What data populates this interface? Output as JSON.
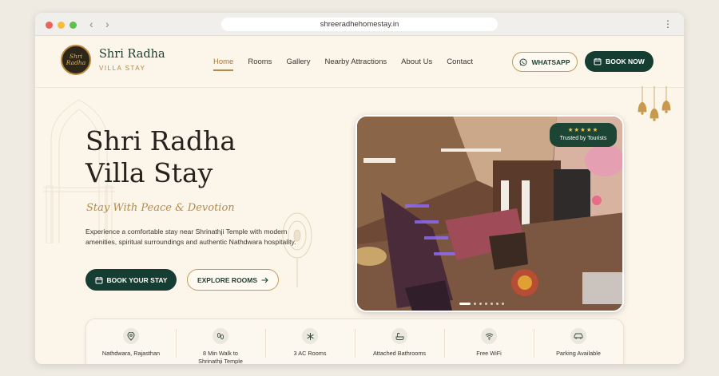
{
  "browser": {
    "url": "shreeradhehomestay.in"
  },
  "brand": {
    "name": "Shri Radha",
    "subtitle": "VILLA STAY",
    "logo_text": "Shri Radha",
    "accent_color": "#b58b46",
    "primary_color": "#163d31"
  },
  "nav": {
    "items": [
      "Home",
      "Rooms",
      "Gallery",
      "Nearby Attractions",
      "About Us",
      "Contact"
    ],
    "active": "Home"
  },
  "header_buttons": {
    "whatsapp": "WHATSAPP",
    "book_now": "BOOK NOW"
  },
  "hero": {
    "title_line1": "Shri Radha",
    "title_line2": "Villa Stay",
    "tagline": "Stay With Peace & Devotion",
    "description": "Experience a comfortable stay near Shrinathji Temple with modern amenities, spiritual surroundings and authentic Nathdwara hospitality.",
    "primary_button": "BOOK YOUR STAY",
    "secondary_button": "EXPLORE ROOMS"
  },
  "photo": {
    "badge_stars": "★★★★★",
    "badge_text": "Trusted by Tourists",
    "slide_count": 7,
    "active_slide": 1
  },
  "features": [
    {
      "icon": "map-pin-icon",
      "label": "Nathdwara, Rajasthan"
    },
    {
      "icon": "footsteps-icon",
      "label_line1": "8 Min Walk to",
      "label_line2": "Shrinathji Temple"
    },
    {
      "icon": "snowflake-icon",
      "label": "3 AC Rooms"
    },
    {
      "icon": "bathtub-icon",
      "label": "Attached Bathrooms"
    },
    {
      "icon": "wifi-icon",
      "label": "Free WiFi"
    },
    {
      "icon": "car-icon",
      "label": "Parking Available"
    }
  ]
}
